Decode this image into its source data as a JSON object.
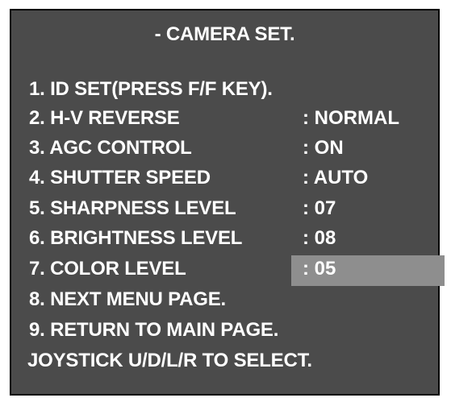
{
  "menu": {
    "title": "- CAMERA SET.",
    "items": [
      {
        "label": "1. ID SET(PRESS F/F KEY).",
        "value": ""
      },
      {
        "label": "2. H-V REVERSE",
        "value": ": NORMAL"
      },
      {
        "label": "3. AGC CONTROL",
        "value": ": ON"
      },
      {
        "label": "4. SHUTTER SPEED",
        "value": ": AUTO"
      },
      {
        "label": "5. SHARPNESS LEVEL",
        "value": ": 07"
      },
      {
        "label": "6. BRIGHTNESS LEVEL",
        "value": ": 08"
      },
      {
        "label": "7. COLOR LEVEL",
        "value": ": 05"
      },
      {
        "label": "8. NEXT MENU PAGE.",
        "value": ""
      },
      {
        "label": "9. RETURN TO MAIN PAGE.",
        "value": ""
      }
    ],
    "footer": "JOYSTICK U/D/L/R TO SELECT.",
    "selected_item": "7. COLOR LEVEL",
    "colors": {
      "background": "#4b4b4b",
      "text": "#ffffff",
      "highlight": "#8e8e8e",
      "border": "#000000"
    }
  }
}
